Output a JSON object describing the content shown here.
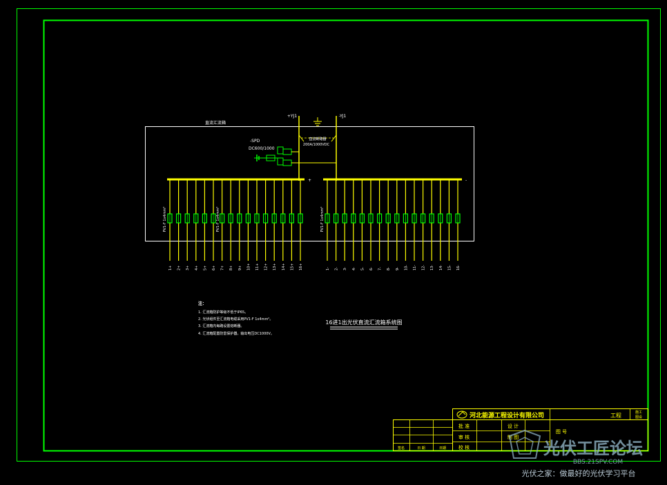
{
  "diagram": {
    "cabinet_title": "直流汇流箱",
    "neg_output": "-YJ1",
    "pos_output": "+YJ1",
    "spd_label": "-SPD",
    "spd_rating": "DC600/1000",
    "switch_label": "直流断路器",
    "switch_rating": "200A/1000VDC",
    "pos_bus_sign": "+",
    "neg_bus_sign": "-",
    "cable_label": "PV1-F 1x4mm²",
    "pos_inputs": [
      "1+",
      "2+",
      "3+",
      "4+",
      "5+",
      "6+",
      "7+",
      "8+",
      "9+",
      "10+",
      "11+",
      "12+",
      "13+",
      "14+",
      "15+",
      "16+"
    ],
    "neg_inputs": [
      "1-",
      "2-",
      "3-",
      "4-",
      "5-",
      "6-",
      "7-",
      "8-",
      "9-",
      "10-",
      "11-",
      "12-",
      "13-",
      "14-",
      "15-",
      "16-"
    ]
  },
  "notes": {
    "heading": "注：",
    "items": [
      "1. 汇流箱防护等级不低于IP65。",
      "2. 光伏组件至汇流箱电缆采用PV1-F 1x4mm²。",
      "3. 汇流箱内每路设置熔断器。",
      "4. 汇流箱配置防雷保护器，输出电压DC1000V。"
    ]
  },
  "drawing_title": "16进1出光伏直流汇流箱系统图",
  "title_block": {
    "company": "河北能源工程设计有限公司",
    "project": "工程",
    "stage_top": "施工",
    "stage_bottom": "图设",
    "row1_left": "批 准",
    "row1_right": "设 计",
    "row2_left": "审 核",
    "row2_right": "制 图",
    "row3_left": "校 核",
    "row3_right": "",
    "drawing_no": "图 号",
    "revision_cells": [
      "签名",
      "日 期",
      "日期"
    ]
  },
  "watermark": {
    "logo_text": "光伏工匠论坛",
    "url": "BBS.21SPV.COM",
    "slogan": "光伏之家：做最好的光伏学习平台"
  }
}
